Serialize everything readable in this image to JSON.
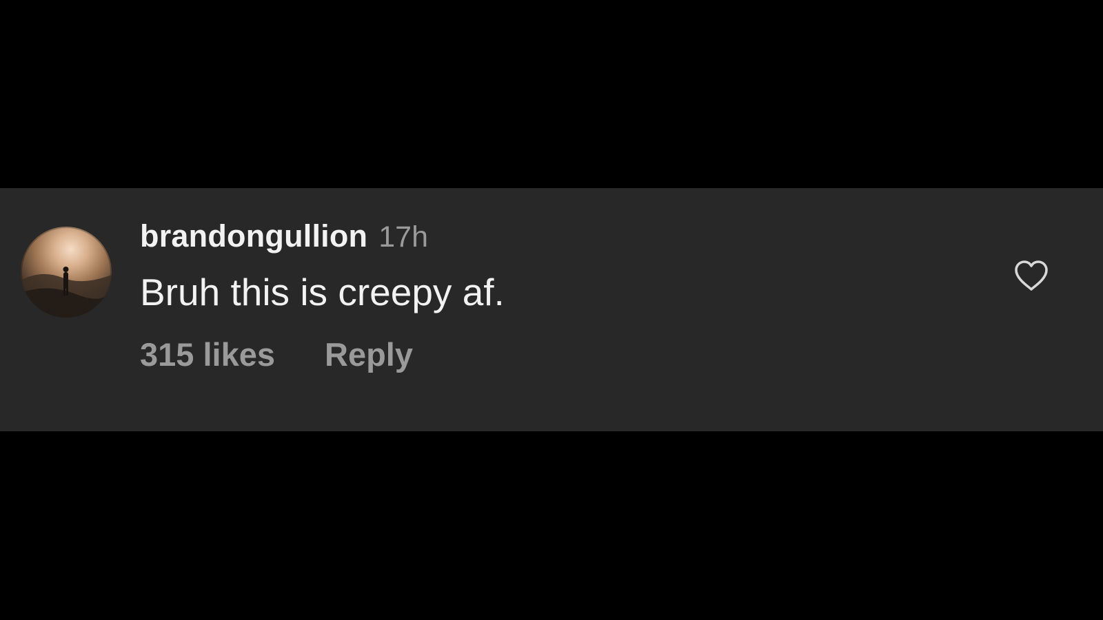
{
  "comment": {
    "username": "brandongullion",
    "timestamp": "17h",
    "text": "Bruh this is creepy af.",
    "likes_label": "315 likes",
    "reply_label": "Reply"
  },
  "icons": {
    "like": "heart-outline-icon",
    "avatar": "user-avatar"
  },
  "colors": {
    "background": "#000000",
    "card": "#282828",
    "primary_text": "#f2f2f2",
    "secondary_text": "#9a9a9a"
  }
}
